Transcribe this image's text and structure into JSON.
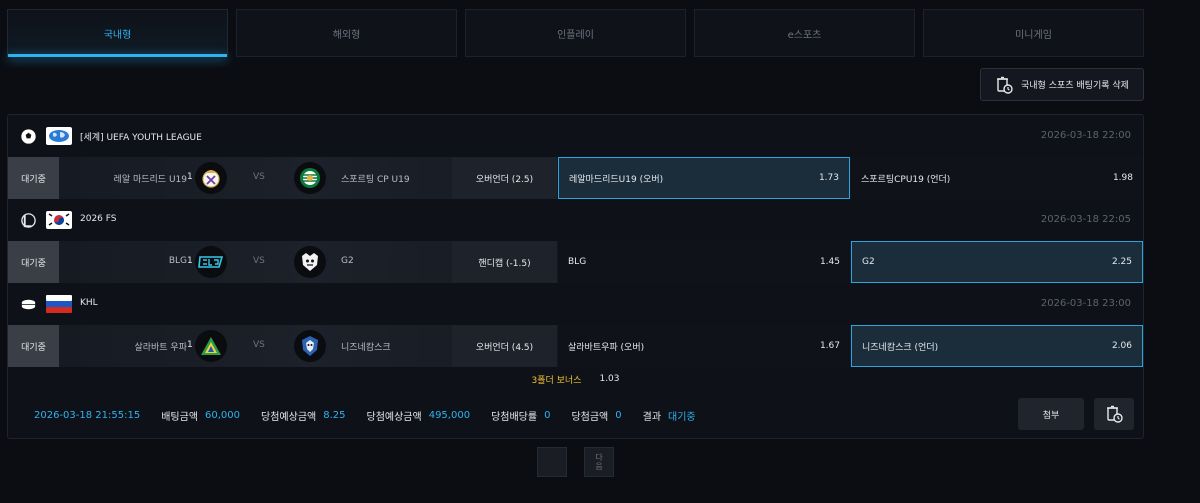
{
  "tabs": [
    "국내형",
    "해외형",
    "인플레이",
    "e스포츠",
    "미니게임"
  ],
  "delete_button_label": "국내형 스포츠 배팅기록 삭제",
  "leagues": [
    {
      "name": "[세계] UEFA YOUTH LEAGUE",
      "datetime": "2026-03-18 22:00",
      "sport_icon": "soccer-ball-icon",
      "flag_icon": "world-flag-icon",
      "match": {
        "status": "대기중",
        "home": "레알 마드리드 U19",
        "home_score": "1",
        "vs": "VS",
        "away": "스포르팅 CP U19",
        "market": "오버언더 (2.5)",
        "option1": {
          "label": "레알마드리드U19 (오버)",
          "odds": "1.73"
        },
        "option2": {
          "label": "스포르팅CPU19 (언더)",
          "odds": "1.98"
        }
      }
    },
    {
      "name": "2026 FS",
      "datetime": "2026-03-18 22:05",
      "sport_icon": "lol-icon",
      "flag_icon": "korea-flag-icon",
      "match": {
        "status": "대기중",
        "home": "BLG",
        "home_score": "1",
        "vs": "VS",
        "away": "G2",
        "market": "핸디캡 (-1.5)",
        "option1": {
          "label": "BLG",
          "odds": "1.45"
        },
        "option2": {
          "label": "G2",
          "odds": "2.25"
        }
      }
    },
    {
      "name": "KHL",
      "datetime": "2026-03-18 23:00",
      "sport_icon": "hockey-puck-icon",
      "flag_icon": "russia-flag-icon",
      "match": {
        "status": "대기중",
        "home": "살라바트 우파",
        "home_score": "1",
        "vs": "VS",
        "away": "니즈네캄스크",
        "market": "오버언더 (4.5)",
        "option1": {
          "label": "살라바트우파 (오버)",
          "odds": "1.67"
        },
        "option2": {
          "label": "니즈네캄스크 (언더)",
          "odds": "2.06"
        }
      }
    }
  ],
  "bonus": {
    "label": "3폴더 보너스",
    "value": "1.03"
  },
  "summary": {
    "time": "2026-03-18 21:55:15",
    "bet_amount_label": "배팅금액",
    "bet_amount": "60,000",
    "expected_odds_label": "당첨예상금액",
    "expected_odds": "8.25",
    "expected_win_label": "당첨예상금액",
    "expected_win": "495,000",
    "win_rate_label": "당첨배당률",
    "win_rate": "0",
    "win_amount_label": "당첨금액",
    "win_amount": "0",
    "result_label": "결과",
    "result": "대기중"
  },
  "attach_button_label": "첨부",
  "pager": {
    "next_label_1": "다",
    "next_label_2": "음"
  },
  "colors": {
    "accent": "#2fb2f2",
    "bonus": "#f2c230",
    "status_bg": "#3a3e47"
  }
}
